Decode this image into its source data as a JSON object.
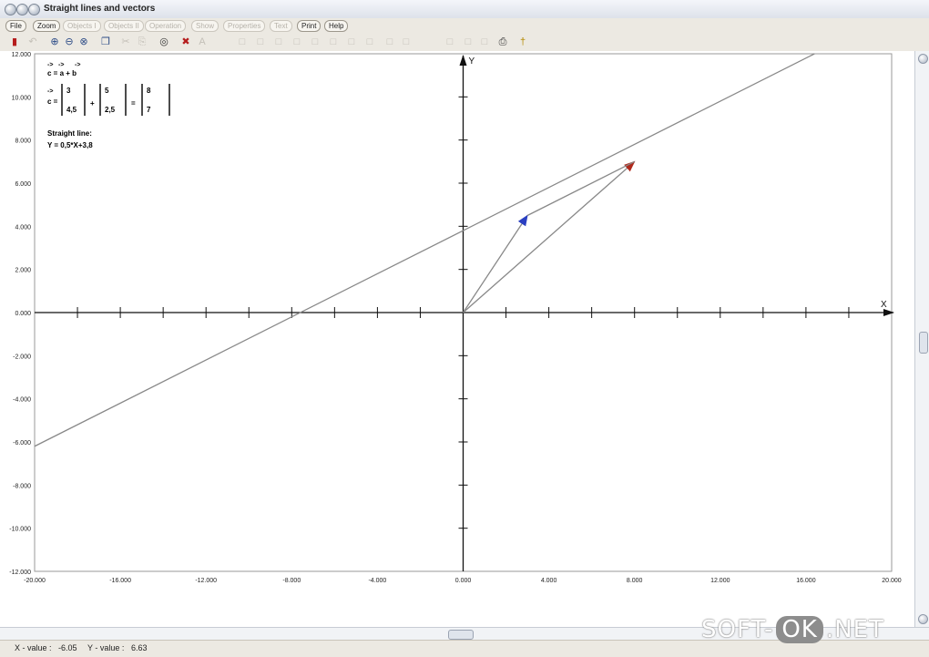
{
  "window": {
    "title": "Straight lines and vectors"
  },
  "menu": {
    "items": [
      {
        "label": "File",
        "enabled": true
      },
      {
        "label": "Zoom",
        "enabled": true
      },
      {
        "label": "Objects I",
        "enabled": false
      },
      {
        "label": "Objects II",
        "enabled": false
      },
      {
        "label": "Operation",
        "enabled": false
      },
      {
        "label": "Show",
        "enabled": false
      },
      {
        "label": "Properties",
        "enabled": false
      },
      {
        "label": "Text",
        "enabled": false
      },
      {
        "label": "Print",
        "enabled": true
      },
      {
        "label": "Help",
        "enabled": true
      }
    ]
  },
  "toolbar": {
    "icons": [
      {
        "name": "exit-icon",
        "enabled": true
      },
      {
        "name": "undo-icon",
        "enabled": false
      },
      {
        "name": "zoom-in-icon",
        "enabled": true
      },
      {
        "name": "zoom-out-icon",
        "enabled": true
      },
      {
        "name": "zoom-fit-icon",
        "enabled": true
      },
      {
        "name": "copy-icon",
        "enabled": true
      },
      {
        "name": "cut-icon",
        "enabled": false
      },
      {
        "name": "paste-icon",
        "enabled": false
      },
      {
        "name": "binoculars-icon",
        "enabled": true
      },
      {
        "name": "erase-icon",
        "enabled": true
      },
      {
        "name": "text-icon",
        "enabled": false
      },
      {
        "name": "tool-1-icon",
        "enabled": false
      },
      {
        "name": "tool-2-icon",
        "enabled": false
      },
      {
        "name": "tool-3-icon",
        "enabled": false
      },
      {
        "name": "tool-4-icon",
        "enabled": false
      },
      {
        "name": "tool-5-icon",
        "enabled": false
      },
      {
        "name": "tool-6-icon",
        "enabled": false
      },
      {
        "name": "tool-7-icon",
        "enabled": false
      },
      {
        "name": "tool-8-icon",
        "enabled": false
      },
      {
        "name": "tool-9-icon",
        "enabled": false
      },
      {
        "name": "tool-10-icon",
        "enabled": false
      },
      {
        "name": "tool-11-icon",
        "enabled": false
      },
      {
        "name": "tool-12-icon",
        "enabled": false
      },
      {
        "name": "tool-13-icon",
        "enabled": false
      },
      {
        "name": "print-icon",
        "enabled": true
      },
      {
        "name": "help-icon",
        "enabled": true
      }
    ]
  },
  "formula": {
    "vector_equation": "c = a + b",
    "arrows_glyph": "->",
    "c_label": "c =",
    "a_top": "3",
    "a_bottom": "4,5",
    "plus": "+",
    "b_top": "5",
    "b_bottom": "2,5",
    "equals": "=",
    "c_top": "8",
    "c_bottom": "7",
    "line_title": "Straight line:",
    "line_equation": "Y = 0,5*X+3,8"
  },
  "chart_data": {
    "type": "line",
    "xlabel": "X",
    "ylabel": "Y",
    "xlim": [
      -20,
      20
    ],
    "ylim": [
      -12,
      12
    ],
    "x_tick_labels": [
      "-20.000",
      "-16.000",
      "-12.000",
      "-8.000",
      "-4.000",
      "0.000",
      "4.000",
      "8.000",
      "12.000",
      "16.000",
      "20.000"
    ],
    "x_tick_values": [
      -20,
      -16,
      -12,
      -8,
      -4,
      0,
      4,
      8,
      12,
      16,
      20
    ],
    "y_tick_labels": [
      "12.000",
      "10.000",
      "8.000",
      "6.000",
      "4.000",
      "2.000",
      "0.000",
      "-2.000",
      "-4.000",
      "-6.000",
      "-8.000",
      "-10.000",
      "-12.000"
    ],
    "y_tick_values": [
      12,
      10,
      8,
      6,
      4,
      2,
      0,
      -2,
      -4,
      -6,
      -8,
      -10,
      -12
    ],
    "minor_tick_step": 2,
    "line": {
      "slope": 0.5,
      "intercept": 3.8,
      "color": "#888888"
    },
    "vectors": [
      {
        "from": [
          0,
          0
        ],
        "to": [
          3,
          4.5
        ],
        "color": "#2a3fc1"
      },
      {
        "from": [
          0,
          0
        ],
        "to": [
          8,
          7
        ],
        "color": "#b0281b"
      },
      {
        "from": [
          3,
          4.5
        ],
        "to": [
          8,
          7
        ],
        "color": "#888888"
      }
    ]
  },
  "status": {
    "x_label": "X - value :",
    "x_value": "-6.05",
    "y_label": "Y - value :",
    "y_value": "6.63"
  },
  "watermark": {
    "left": "SOFT-",
    "box": "OK",
    "right": ".NET"
  }
}
